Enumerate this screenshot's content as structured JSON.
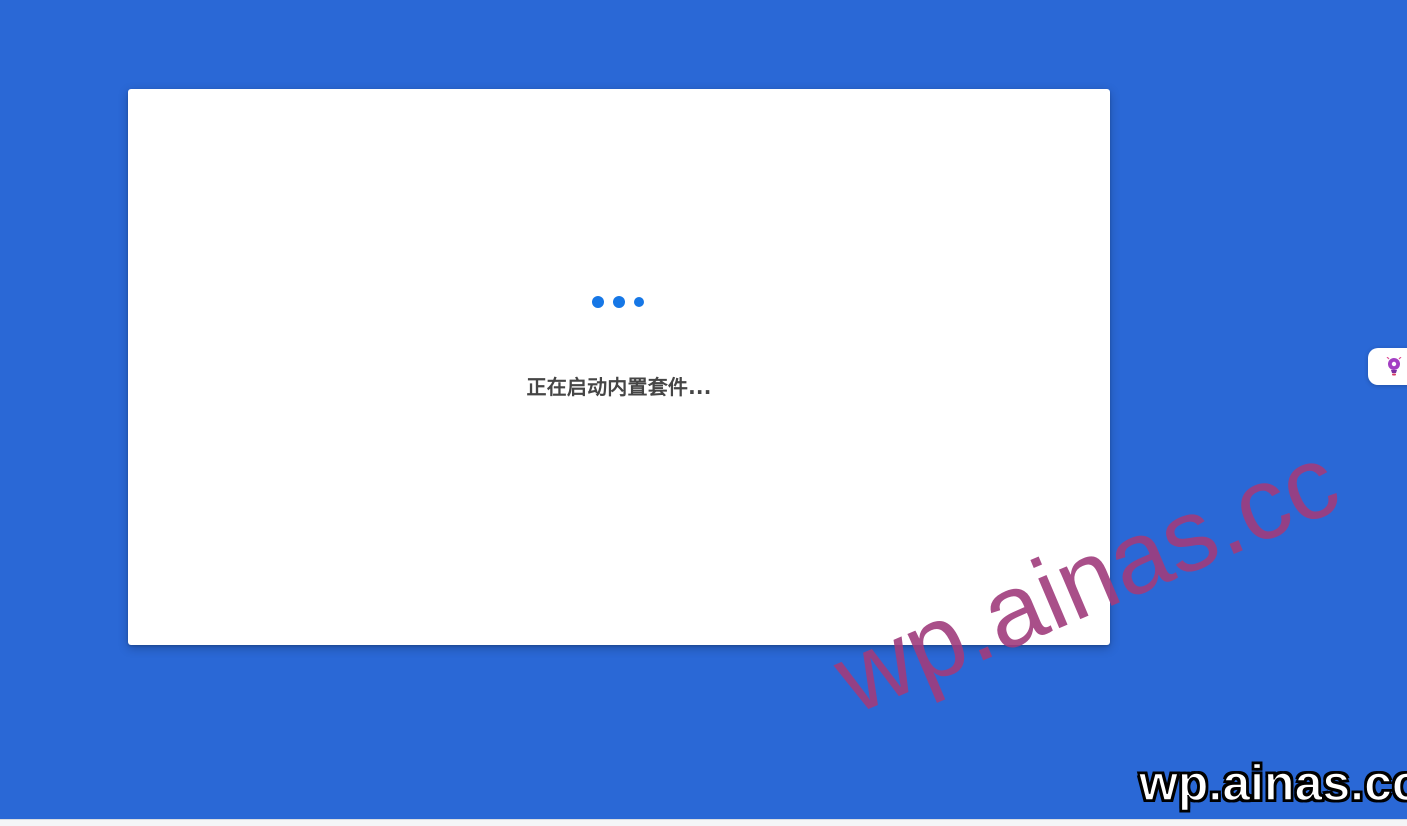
{
  "loading": {
    "status_text": "正在启动内置套件..."
  },
  "side_widget": {
    "icon": "lightbulb-icon"
  },
  "watermark": {
    "text_large": "wp.ainas.cc",
    "text_corner": "wp.ainas.cc"
  },
  "colors": {
    "background": "#2a68d6",
    "card": "#ffffff",
    "dots": "#1677e6",
    "text": "#454545",
    "watermark_large": "#a03c7d"
  }
}
